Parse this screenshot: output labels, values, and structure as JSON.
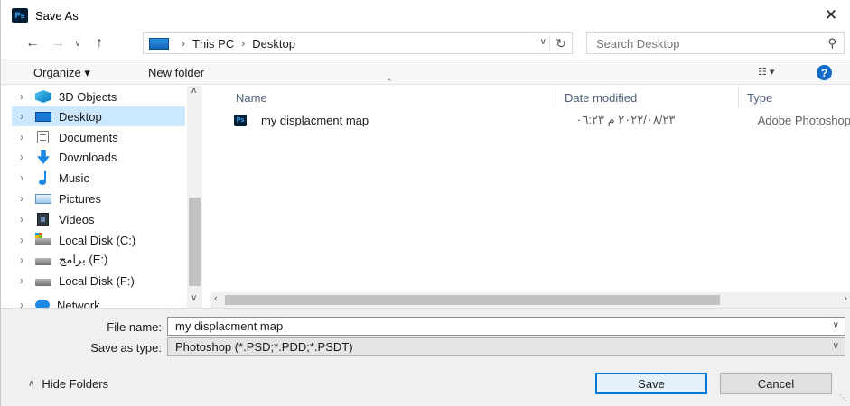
{
  "window": {
    "title": "Save As",
    "app_logo": "Ps",
    "close_glyph": "✕"
  },
  "address": {
    "crumbs": [
      "This PC",
      "Desktop"
    ],
    "search_placeholder": "Search Desktop"
  },
  "toolbar": {
    "organize_label": "Organize ▾",
    "new_folder_label": "New folder"
  },
  "nav_pane": {
    "items": [
      {
        "label": "3D Objects",
        "icon": "3d-objects-icon"
      },
      {
        "label": "Desktop",
        "icon": "desktop-icon",
        "selected": true
      },
      {
        "label": "Documents",
        "icon": "documents-icon"
      },
      {
        "label": "Downloads",
        "icon": "downloads-icon"
      },
      {
        "label": "Music",
        "icon": "music-icon"
      },
      {
        "label": "Pictures",
        "icon": "pictures-icon"
      },
      {
        "label": "Videos",
        "icon": "videos-icon"
      },
      {
        "label": "Local Disk (C:)",
        "icon": "system-disk-icon"
      },
      {
        "label": "برامج (E:)",
        "icon": "disk-icon"
      },
      {
        "label": "Local Disk (F:)",
        "icon": "disk-icon"
      },
      {
        "label": "Network",
        "icon": "network-icon"
      }
    ]
  },
  "file_list": {
    "columns": [
      "Name",
      "Date modified",
      "Type"
    ],
    "rows": [
      {
        "name": "my displacment map",
        "date_modified": "٢٠٢٢/٠٨/٢٣ م ٠٦:٢٣",
        "type": "Adobe Photoshop"
      }
    ]
  },
  "form": {
    "file_name_label": "File name:",
    "file_name_value": "my displacment map",
    "save_type_label": "Save as type:",
    "save_type_value": "Photoshop (*.PSD;*.PDD;*.PSDT)"
  },
  "footer": {
    "hide_folders_label": "Hide Folders",
    "save_label": "Save",
    "cancel_label": "Cancel"
  },
  "colors": {
    "selection": "#cce8ff",
    "accent": "#0078d7",
    "ps_dark": "#001e36",
    "ps_blue": "#31a8ff"
  }
}
